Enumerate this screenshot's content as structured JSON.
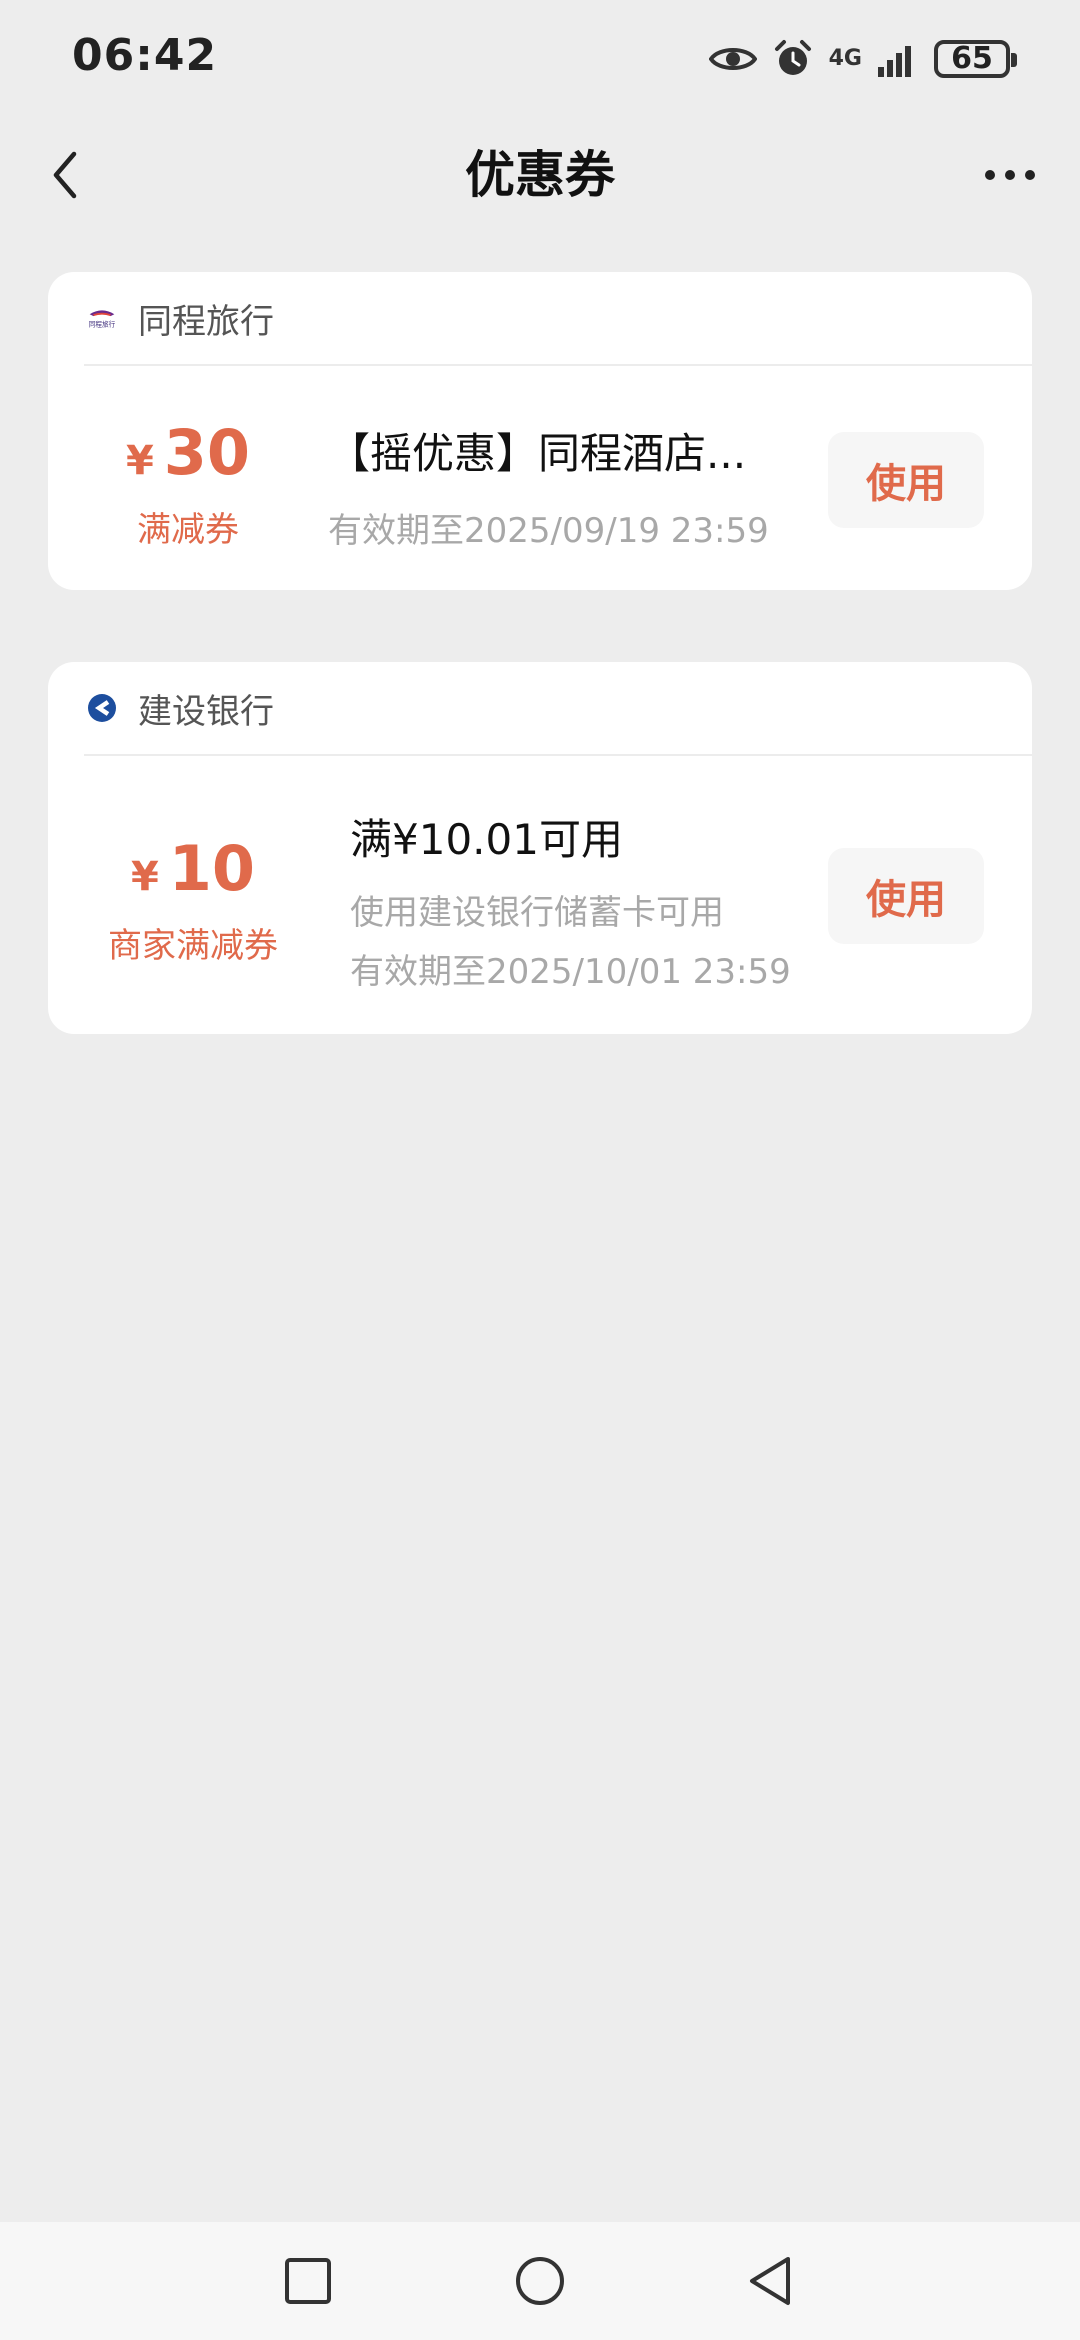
{
  "status_bar": {
    "time": "06:42",
    "network": "4G",
    "battery": "65",
    "icons": [
      "eye-icon",
      "alarm-icon",
      "signal-icon",
      "battery-icon"
    ]
  },
  "header": {
    "title": "优惠券",
    "back_icon": "chevron-left-icon",
    "more_icon": "more-dots-icon"
  },
  "coupons": [
    {
      "brand": "同程旅行",
      "brand_logo": "同程旅行",
      "currency": "¥",
      "amount": "30",
      "type": "满减券",
      "title": "【摇优惠】同程酒店...",
      "lines": [
        "有效期至2025/09/19 23:59"
      ],
      "button": "使用"
    },
    {
      "brand": "建设银行",
      "currency": "¥",
      "amount": "10",
      "type": "商家满减券",
      "title": "满¥10.01可用",
      "lines": [
        "使用建设银行储蓄卡可用",
        "有效期至2025/10/01 23:59"
      ],
      "button": "使用"
    }
  ],
  "colors": {
    "accent": "#e06a4b",
    "background": "#ededed",
    "card": "#ffffff",
    "muted_text": "#a8a8a8"
  },
  "nav_bar": {
    "buttons": [
      "recents-square-icon",
      "home-circle-icon",
      "back-triangle-icon"
    ]
  }
}
